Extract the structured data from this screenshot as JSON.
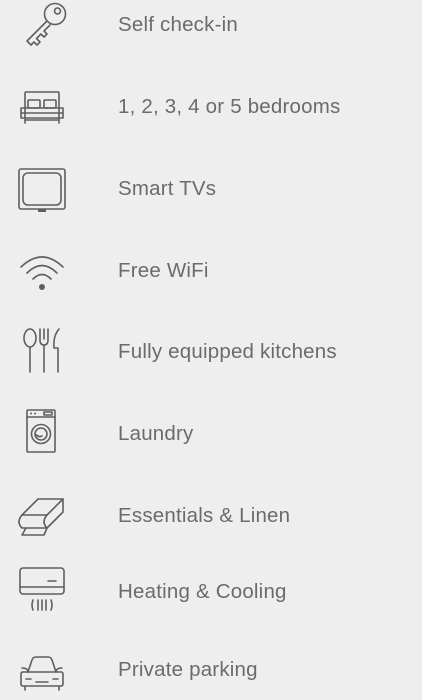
{
  "amenities": [
    {
      "icon": "key-icon",
      "label": "Self check-in"
    },
    {
      "icon": "bed-icon",
      "label": "1, 2, 3, 4 or 5 bedrooms"
    },
    {
      "icon": "tv-icon",
      "label": "Smart TVs"
    },
    {
      "icon": "wifi-icon",
      "label": "Free WiFi"
    },
    {
      "icon": "cutlery-icon",
      "label": "Fully equipped kitchens"
    },
    {
      "icon": "washing-machine-icon",
      "label": "Laundry"
    },
    {
      "icon": "folded-linen-icon",
      "label": "Essentials & Linen"
    },
    {
      "icon": "air-conditioner-icon",
      "label": "Heating & Cooling"
    },
    {
      "icon": "car-icon",
      "label": "Private parking"
    }
  ],
  "colors": {
    "background": "#efeeee",
    "text": "#6b6b6b",
    "icon": "#5f5f5f"
  }
}
